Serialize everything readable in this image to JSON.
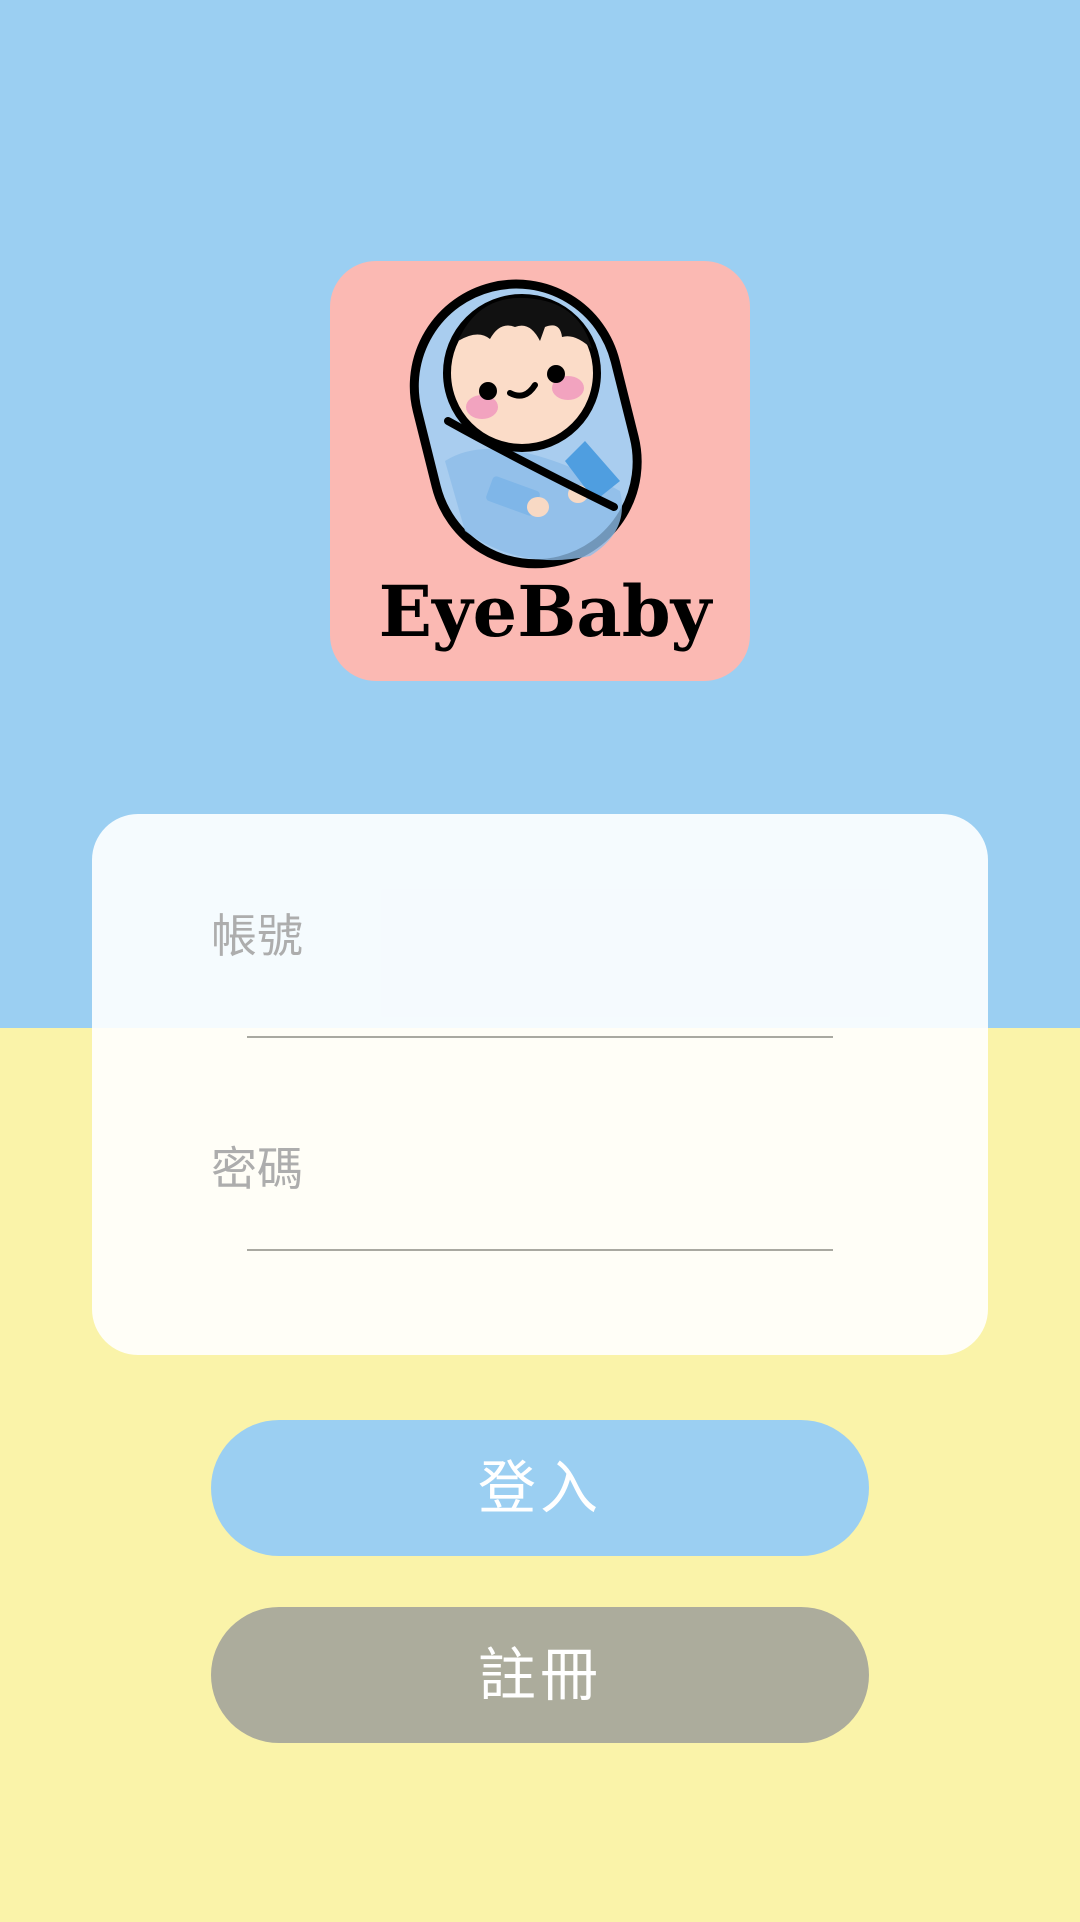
{
  "colors": {
    "top_background": "#9bcff2",
    "bottom_background": "#faf3a9",
    "logo_background": "#fbb9b3",
    "login_button": "#9bcff2",
    "register_button": "#acac9c"
  },
  "logo": {
    "text": "EyeBaby",
    "icon": "swaddled-baby-icon"
  },
  "form": {
    "account_placeholder": "帳號",
    "password_placeholder": "密碼"
  },
  "buttons": {
    "login_label": "登入",
    "register_label": "註冊"
  }
}
